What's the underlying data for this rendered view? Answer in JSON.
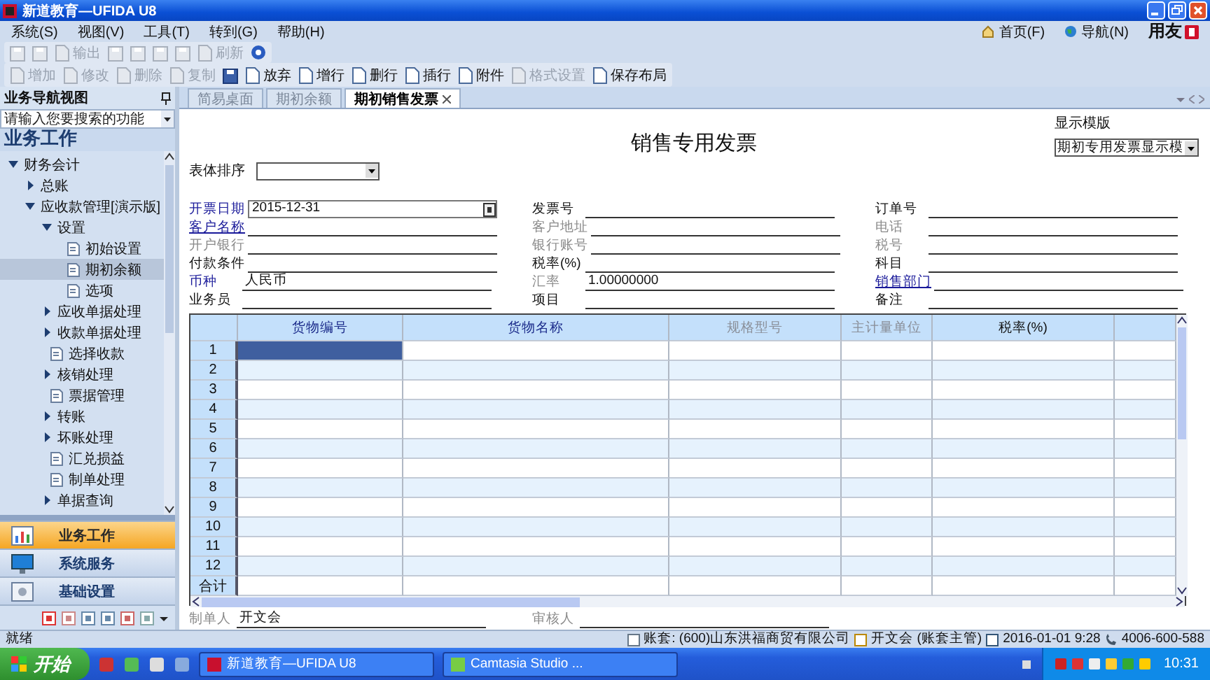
{
  "window": {
    "title": "新道教育—UFIDA U8"
  },
  "menu": [
    "系统(S)",
    "视图(V)",
    "工具(T)",
    "转到(G)",
    "帮助(H)"
  ],
  "quick_links": [
    "首页(F)",
    "导航(N)"
  ],
  "brand": "用友",
  "toolbar_1": [
    {
      "kind": "icon",
      "disabled": true
    },
    {
      "kind": "icon",
      "disabled": true
    },
    {
      "kind": "button",
      "label": "输出",
      "disabled": true
    },
    {
      "kind": "icon",
      "disabled": true
    },
    {
      "kind": "icon",
      "disabled": true
    },
    {
      "kind": "icon",
      "disabled": true
    },
    {
      "kind": "icon",
      "disabled": true
    },
    {
      "kind": "button",
      "label": "刷新",
      "disabled": true
    },
    {
      "kind": "help",
      "disabled": false
    }
  ],
  "toolbar_2": [
    {
      "kind": "button",
      "label": "增加",
      "disabled": true
    },
    {
      "kind": "button",
      "label": "修改",
      "disabled": true
    },
    {
      "kind": "button",
      "label": "删除",
      "disabled": true
    },
    {
      "kind": "button",
      "label": "复制",
      "disabled": true
    },
    {
      "kind": "icon",
      "disabled": false
    },
    {
      "kind": "button",
      "label": "放弃",
      "disabled": false
    },
    {
      "kind": "button",
      "label": "增行",
      "disabled": false
    },
    {
      "kind": "button",
      "label": "删行",
      "disabled": false
    },
    {
      "kind": "button",
      "label": "插行",
      "disabled": false
    },
    {
      "kind": "button",
      "label": "附件",
      "disabled": false
    },
    {
      "kind": "button",
      "label": "格式设置",
      "disabled": true
    },
    {
      "kind": "button",
      "label": "保存布局",
      "disabled": false
    }
  ],
  "navigator": {
    "title": "业务导航视图",
    "search": {
      "placeholder": "请输入您要搜索的功能"
    },
    "section": "业务工作",
    "tree": [
      {
        "label": "财务会计",
        "kind": "folder",
        "expanded": true,
        "children": [
          {
            "label": "总账",
            "kind": "folder",
            "expanded": false
          },
          {
            "label": "应收款管理[演示版]",
            "kind": "folder",
            "expanded": true,
            "children": [
              {
                "label": "设置",
                "kind": "folder",
                "expanded": true,
                "children": [
                  {
                    "label": "初始设置",
                    "kind": "leaf",
                    "selected": false
                  },
                  {
                    "label": "期初余额",
                    "kind": "leaf",
                    "selected": true
                  },
                  {
                    "label": "选项",
                    "kind": "leaf",
                    "selected": false
                  }
                ]
              },
              {
                "label": "应收单据处理",
                "kind": "folder",
                "expanded": false
              },
              {
                "label": "收款单据处理",
                "kind": "folder",
                "expanded": false
              },
              {
                "label": "选择收款",
                "kind": "leaf",
                "selected": false
              },
              {
                "label": "核销处理",
                "kind": "folder",
                "expanded": false
              },
              {
                "label": "票据管理",
                "kind": "leaf",
                "selected": false
              },
              {
                "label": "转账",
                "kind": "folder",
                "expanded": false
              },
              {
                "label": "坏账处理",
                "kind": "folder",
                "expanded": false
              },
              {
                "label": "汇兑损益",
                "kind": "leaf",
                "selected": false
              },
              {
                "label": "制单处理",
                "kind": "leaf",
                "selected": false
              },
              {
                "label": "单据查询",
                "kind": "folder",
                "expanded": false
              }
            ]
          }
        ]
      }
    ],
    "modules": [
      {
        "label": "业务工作",
        "selected": true
      },
      {
        "label": "系统服务",
        "selected": false
      },
      {
        "label": "基础设置",
        "selected": false
      }
    ]
  },
  "tabs": [
    {
      "label": "简易桌面",
      "selected": false,
      "closable": false
    },
    {
      "label": "期初余额",
      "selected": false,
      "closable": false
    },
    {
      "label": "期初销售发票",
      "selected": true,
      "closable": true
    }
  ],
  "invoice": {
    "title": "销售专用发票",
    "template_label": "显示模版",
    "template": "期初专用发票显示模",
    "sort_label": "表体排序",
    "fields": [
      {
        "label": "开票日期",
        "kind": "required",
        "value": "2015-12-31",
        "picker": true
      },
      {
        "label": "发票号",
        "kind": "normal"
      },
      {
        "label": "订单号",
        "kind": "normal"
      },
      {
        "label": "客户名称",
        "kind": "link"
      },
      {
        "label": "客户地址",
        "kind": "disabled"
      },
      {
        "label": "电话",
        "kind": "disabled"
      },
      {
        "label": "开户银行",
        "kind": "disabled"
      },
      {
        "label": "银行账号",
        "kind": "disabled"
      },
      {
        "label": "税号",
        "kind": "disabled"
      },
      {
        "label": "付款条件",
        "kind": "normal"
      },
      {
        "label": "税率(%)",
        "kind": "normal"
      },
      {
        "label": "科目",
        "kind": "normal"
      },
      {
        "label": "币种",
        "kind": "required",
        "value": "人民币"
      },
      {
        "label": "汇率",
        "kind": "disabled",
        "value": "1.00000000"
      },
      {
        "label": "销售部门",
        "kind": "link"
      },
      {
        "label": "业务员",
        "kind": "normal"
      },
      {
        "label": "项目",
        "kind": "normal"
      },
      {
        "label": "备注",
        "kind": "normal"
      }
    ],
    "table": {
      "columns": [
        {
          "label": "货物编号",
          "kind": "required"
        },
        {
          "label": "货物名称",
          "kind": "required"
        },
        {
          "label": "规格型号",
          "kind": "disabled"
        },
        {
          "label": "主计量单位",
          "kind": "disabled"
        },
        {
          "label": "税率(%)",
          "kind": "normal"
        },
        {
          "kind": "normal"
        }
      ],
      "rows": [
        {
          "label": "1",
          "selected": true
        },
        {
          "label": "2",
          "selected": false
        },
        {
          "label": "3",
          "selected": false
        },
        {
          "label": "4",
          "selected": false
        },
        {
          "label": "5",
          "selected": false
        },
        {
          "label": "6",
          "selected": false
        },
        {
          "label": "7",
          "selected": false
        },
        {
          "label": "8",
          "selected": false
        },
        {
          "label": "9",
          "selected": false
        },
        {
          "label": "10",
          "selected": false
        },
        {
          "label": "11",
          "selected": false
        },
        {
          "label": "12",
          "selected": false
        }
      ],
      "total_label": "合计"
    },
    "footer_fields": [
      {
        "label": "制单人",
        "kind": "disabled",
        "value": "开文会"
      },
      {
        "label": "审核人",
        "kind": "disabled"
      }
    ]
  },
  "status_bar": {
    "state": "就绪",
    "account": "账套: (600)山东洪福商贸有限公司",
    "user": "开文会 (账套主管)",
    "datetime": "2016-01-01  9:28",
    "phone": "4006-600-588"
  },
  "taskbar": {
    "start": "开始",
    "tasks": [
      {
        "label": "新道教育—UFIDA U8",
        "selected": false
      },
      {
        "label": "Camtasia Studio ...",
        "selected": false
      }
    ],
    "clock": "10:31"
  }
}
